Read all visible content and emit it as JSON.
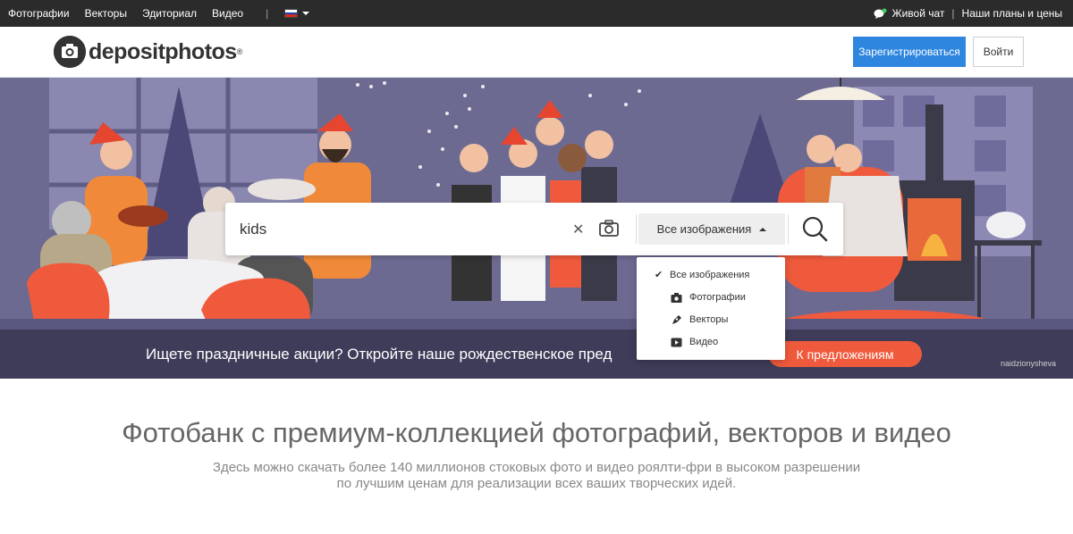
{
  "topbar": {
    "nav": [
      "Фотографии",
      "Векторы",
      "Эдиториал",
      "Видео"
    ],
    "separator": "|",
    "language_flag": "flag-ru-icon",
    "live_chat": "Живой чат",
    "divider": "|",
    "plans": "Наши планы и цены"
  },
  "header": {
    "logo_text": "depositphotos",
    "logo_reg": "®",
    "register_label": "Зарегистрироваться",
    "login_label": "Войти"
  },
  "hero": {
    "search_value": "kids",
    "clear_icon": "close-icon",
    "camera_icon": "camera-icon",
    "type_selected": "Все изображения",
    "search_icon": "search-icon",
    "promo_text": "Ищете праздничные акции? Откройте наше рождественское пред",
    "promo_button": "К предложениям",
    "credit": "naidzionysheva"
  },
  "dropdown": {
    "items": [
      {
        "label": "Все изображения",
        "icon": "check-icon",
        "selected": true
      },
      {
        "label": "Фотографии",
        "icon": "camera-icon"
      },
      {
        "label": "Векторы",
        "icon": "pen-icon"
      },
      {
        "label": "Видео",
        "icon": "video-icon"
      }
    ]
  },
  "intro": {
    "title": "Фотобанк с премиум-коллекцией фотографий, векторов и видео",
    "subtitle_line1": "Здесь можно скачать более 140 миллионов стоковых фото и видео роялти-фри в высоком разрешении",
    "subtitle_line2": "по лучшим ценам для реализации всех ваших творческих идей."
  },
  "colors": {
    "topbar_bg": "#2b2b2b",
    "register_blue": "#2f86df",
    "promo_orange": "#f05a3c",
    "hero_bg": "#6d6a92"
  }
}
